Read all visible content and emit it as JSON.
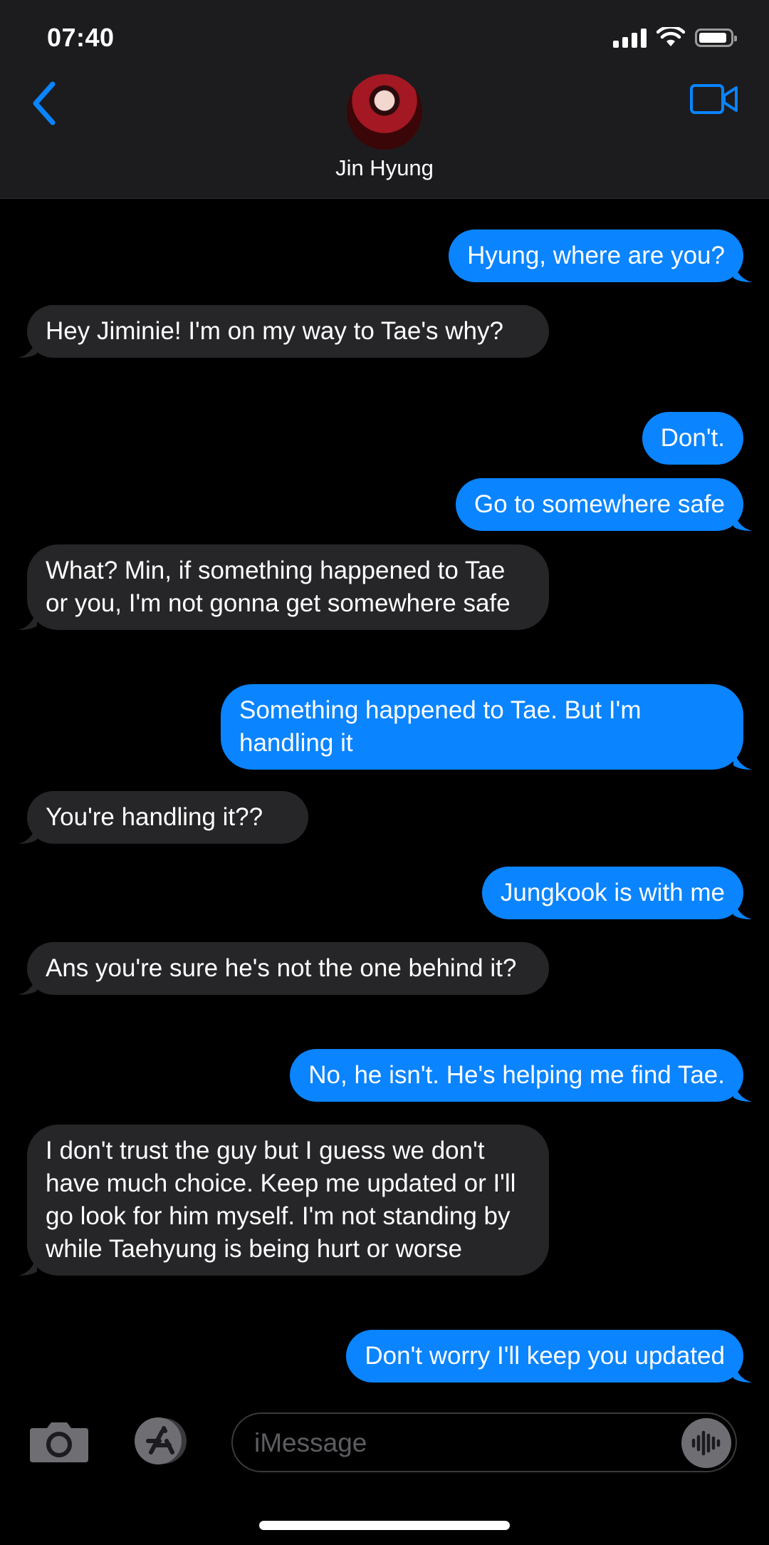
{
  "status_bar": {
    "time": "07:40"
  },
  "header": {
    "contact_name": "Jin Hyung"
  },
  "messages": [
    {
      "from": "me",
      "text": "Hyung, where are you?"
    },
    {
      "from": "contact",
      "text": "Hey Jiminie! I'm on my way to Tae's why?"
    },
    {
      "from": "me",
      "text": "Don't."
    },
    {
      "from": "me",
      "text": "Go to somewhere safe"
    },
    {
      "from": "contact",
      "text": "What? Min, if something happened to Tae or you, I'm not gonna get somewhere safe"
    },
    {
      "from": "me",
      "text": "Something happened to Tae. But I'm handling it"
    },
    {
      "from": "contact",
      "text": "You're handling it??"
    },
    {
      "from": "me",
      "text": "Jungkook is with me"
    },
    {
      "from": "contact",
      "text": "Ans you're sure he's not the one behind it?"
    },
    {
      "from": "me",
      "text": "No, he isn't. He's helping me find Tae."
    },
    {
      "from": "contact",
      "text": "I don't trust the guy but I guess we don't have much choice. Keep me updated or I'll go look for him myself. I'm not standing by while Taehyung is being hurt or worse"
    },
    {
      "from": "me",
      "text": "Don't worry I'll keep you updated"
    }
  ],
  "input": {
    "placeholder": "iMessage"
  },
  "colors": {
    "sent_bubble": "#0a84ff",
    "received_bubble": "#262628",
    "accent": "#0a84ff"
  }
}
